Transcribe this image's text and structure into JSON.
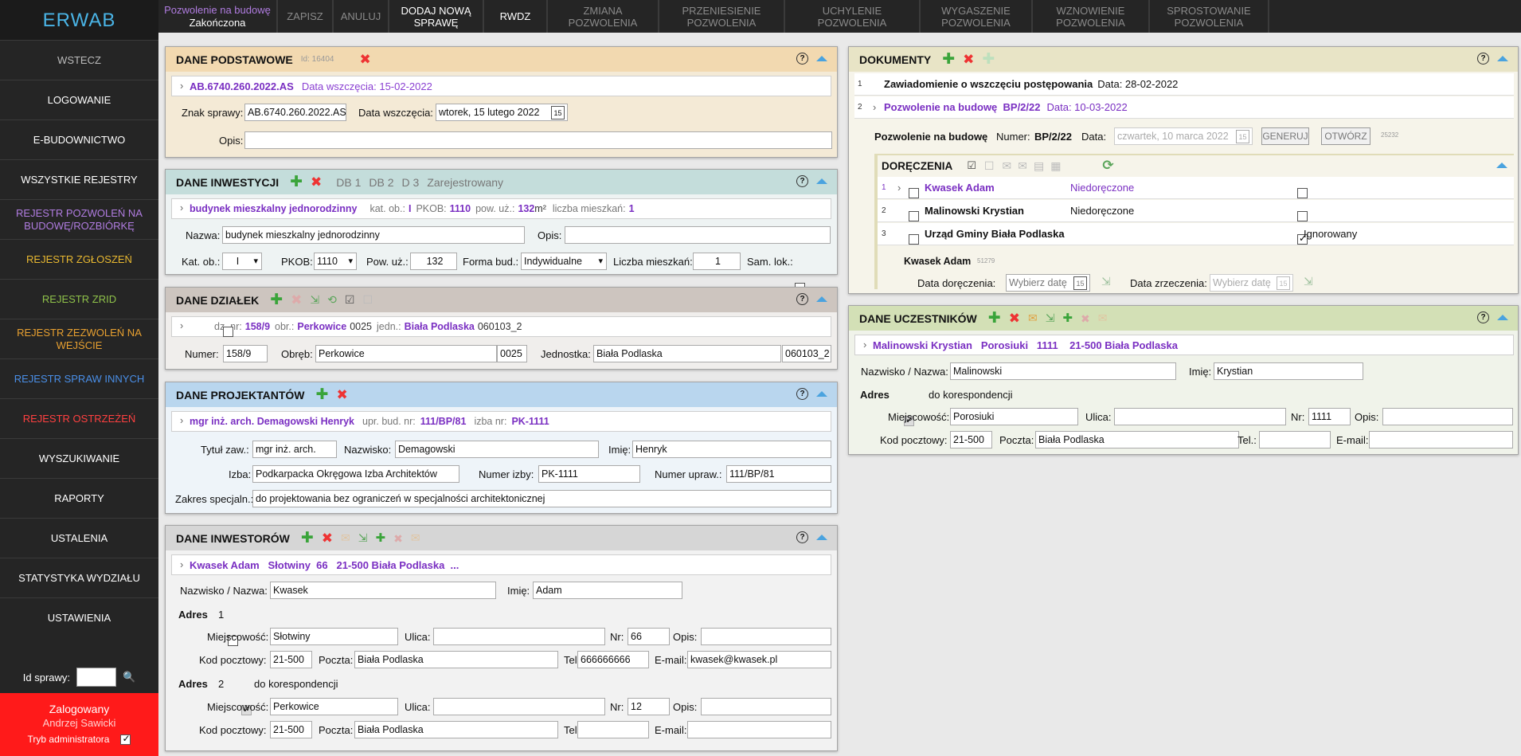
{
  "app": {
    "logo": "ERWAB"
  },
  "sidebar": {
    "items": [
      {
        "label": "WSTECZ",
        "color": "#bbbbbb"
      },
      {
        "label": "LOGOWANIE",
        "color": "#ffffff"
      },
      {
        "label": "E-BUDOWNICTWO",
        "color": "#ffffff"
      },
      {
        "label": "WSZYSTKIE REJESTRY",
        "color": "#ffffff"
      },
      {
        "label": "REJESTR POZWOLEŃ NA BUDOWĘ/ROZBIÓRKĘ",
        "color": "#b07ce0"
      },
      {
        "label": "REJESTR ZGŁOSZEŃ",
        "color": "#e8b830"
      },
      {
        "label": "REJESTR ZRID",
        "color": "#8fc24a"
      },
      {
        "label": "REJESTR ZEZWOLEŃ NA WEJŚCIE",
        "color": "#e8a030"
      },
      {
        "label": "REJESTR SPRAW INNYCH",
        "color": "#4a8fe8"
      },
      {
        "label": "REJESTR OSTRZEŻEŃ",
        "color": "#ff4040"
      },
      {
        "label": "WYSZUKIWANIE",
        "color": "#ffffff"
      },
      {
        "label": "RAPORTY",
        "color": "#ffffff"
      },
      {
        "label": "USTALENIA",
        "color": "#ffffff"
      },
      {
        "label": "STATYSTYKA WYDZIAŁU",
        "color": "#ffffff"
      },
      {
        "label": "USTAWIENIA",
        "color": "#ffffff"
      }
    ],
    "id_label": "Id sprawy:",
    "user": {
      "status": "Zalogowany",
      "name": "Andrzej Sawicki",
      "admin_label": "Tryb administratora"
    }
  },
  "topbar": {
    "case_type": "Pozwolenie na budowę",
    "case_status": "Zakończona",
    "tabs": [
      {
        "label": "ZAPISZ",
        "dim": true
      },
      {
        "label": "ANULUJ",
        "dim": true
      },
      {
        "label": "DODAJ NOWĄ SPRAWĘ",
        "dim": false
      },
      {
        "label": "RWDZ",
        "dim": false
      },
      {
        "label": "ZMIANA POZWOLENIA",
        "dim": true
      },
      {
        "label": "PRZENIESIENIE POZWOLENIA",
        "dim": true
      },
      {
        "label": "UCHYLENIE POZWOLENIA",
        "dim": true
      },
      {
        "label": "WYGASZENIE POZWOLENIA",
        "dim": true
      },
      {
        "label": "WZNOWIENIE POZWOLENIA",
        "dim": true
      },
      {
        "label": "SPROSTOWANIE POZWOLENIA",
        "dim": true
      }
    ]
  },
  "podstawowe": {
    "title": "DANE PODSTAWOWE",
    "id": "Id: 16404",
    "summary_sign": "AB.6740.260.2022.AS",
    "summary_date": "Data wszczęcia: 15-02-2022",
    "znak_label": "Znak sprawy:",
    "znak": "AB.6740.260.2022.AS",
    "data_label": "Data wszczęcia:",
    "data": "wtorek, 15 lutego 2022",
    "opis_label": "Opis:"
  },
  "inwestycji": {
    "title": "DANE INWESTYCJI",
    "tags": [
      "DB 1",
      "DB 2",
      "D 3",
      "Zarejestrowany"
    ],
    "summary_name": "budynek mieszkalny jednorodzinny",
    "s_kat_l": "kat. ob.:",
    "s_kat": "I",
    "s_pkob_l": "PKOB:",
    "s_pkob": "1110",
    "s_pow_l": "pow. uż.:",
    "s_pow": "132",
    "s_pow_unit": "m²",
    "s_lm_l": "liczba mieszkań:",
    "s_lm": "1",
    "nazwa_label": "Nazwa:",
    "nazwa": "budynek mieszkalny jednorodzinny",
    "opis_label": "Opis:",
    "kat_label": "Kat. ob.:",
    "kat": "I",
    "pkob_label": "PKOB:",
    "pkob": "1110",
    "pow_label": "Pow. uż.:",
    "pow": "132",
    "forma_label": "Forma bud.:",
    "forma": "Indywidualne",
    "lm_label": "Liczba mieszkań:",
    "lm": "1",
    "samlok_label": "Sam. lok.:"
  },
  "dzialek": {
    "title": "DANE DZIAŁEK",
    "s_dz_l": "dz. nr:",
    "s_dz": "158/9",
    "s_obr_l": "obr.:",
    "s_obr": "Perkowice",
    "s_obr_code": "0025",
    "s_jedn_l": "jedn.:",
    "s_jedn": "Biała Podlaska",
    "s_jedn_code": "060103_2",
    "numer_label": "Numer:",
    "numer": "158/9",
    "obreb_label": "Obręb:",
    "obreb": "Perkowice",
    "obreb_code": "0025",
    "jedn_label": "Jednostka:",
    "jedn": "Biała Podlaska",
    "jedn_code": "060103_2"
  },
  "projektantow": {
    "title": "DANE PROJEKTANTÓW",
    "s_name": "mgr inż. arch. Demagowski Henryk",
    "s_upr_l": "upr. bud. nr:",
    "s_upr": "111/BP/81",
    "s_izba_l": "izba nr:",
    "s_izba": "PK-1111",
    "tytul_label": "Tytuł zaw.:",
    "tytul": "mgr inż. arch.",
    "nazwisko_label": "Nazwisko:",
    "nazwisko": "Demagowski",
    "imie_label": "Imię:",
    "imie": "Henryk",
    "izba_label": "Izba:",
    "izba": "Podkarpacka Okręgowa Izba Architektów",
    "nrizby_label": "Numer izby:",
    "nrizby": "PK-1111",
    "nrupr_label": "Numer upraw.:",
    "nrupr": "111/BP/81",
    "zakres_label": "Zakres specjaln.:",
    "zakres": "do projektowania bez ograniczeń w specjalności architektonicznej"
  },
  "inwestorow": {
    "title": "DANE INWESTORÓW",
    "summary": "Kwasek Adam   Słotwiny  66   21-500 Biała Podlaska  ...",
    "nazw_label": "Nazwisko / Nazwa:",
    "nazw": "Kwasek",
    "imie_label": "Imię:",
    "imie": "Adam",
    "adres_label": "Adres",
    "kores_label": "do korespondencji",
    "addr1": {
      "no": "1",
      "miejsc": "Słotwiny",
      "ulica": "",
      "nr": "66",
      "opis": "",
      "kod": "21-500",
      "poczta": "Biała Podlaska",
      "tel": "666666666",
      "email": "kwasek@kwasek.pl"
    },
    "addr2": {
      "no": "2",
      "miejsc": "Perkowice",
      "ulica": "",
      "nr": "12",
      "opis": "",
      "kod": "21-500",
      "poczta": "Biała Podlaska",
      "tel": "",
      "email": ""
    },
    "l_miejsc": "Miejscowość:",
    "l_ulica": "Ulica:",
    "l_nr": "Nr:",
    "l_opis": "Opis:",
    "l_kod": "Kod pocztowy:",
    "l_poczta": "Poczta:",
    "l_tel": "Tel.:",
    "l_email": "E-mail:"
  },
  "dokumenty": {
    "title": "DOKUMENTY",
    "rows": [
      {
        "no": "1",
        "name": "Zawiadomienie o wszczęciu postępowania",
        "date": "Data: 28-02-2022"
      },
      {
        "no": "2",
        "name": "Pozwolenie na budowę  BP/2/22",
        "date": "Data: 10-03-2022"
      }
    ],
    "det_name": "Pozwolenie na budowę",
    "det_num_l": "Numer:",
    "det_num": "BP/2/22",
    "det_data_l": "Data:",
    "det_data": "czwartek, 10 marca 2022",
    "generuj": "GENERUJ",
    "otworz": "OTWÓRZ",
    "det_id": "25232",
    "dor_title": "DORĘCZENIA",
    "dor_rows": [
      {
        "no": "1",
        "name": "Kwasek Adam",
        "status": "Niedoręczone",
        "ign": "",
        "checked": false
      },
      {
        "no": "2",
        "name": "Malinowski Krystian",
        "status": "Niedoręczone",
        "ign": "",
        "checked": false
      },
      {
        "no": "3",
        "name": "Urząd Gminy Biała Podlaska",
        "status": "",
        "ign": "Ignorowany",
        "checked": true
      }
    ],
    "dor_person": "Kwasek Adam",
    "dor_person_id": "51279",
    "dor_date_l": "Data doręczenia:",
    "dor_date": "Wybierz datę",
    "zrz_l": "Data zrzeczenia:",
    "zrz": "Wybierz datę"
  },
  "uczestnikow": {
    "title": "DANE UCZESTNIKÓW",
    "summary": "Malinowski Krystian   Porosiuki   1111    21-500 Biała Podlaska",
    "nazw_label": "Nazwisko / Nazwa:",
    "nazw": "Malinowski",
    "imie_label": "Imię:",
    "imie": "Krystian",
    "adres_label": "Adres",
    "kores_label": "do korespondencji",
    "miejsc": "Porosiuki",
    "ulica": "",
    "nr": "1111",
    "opis": "",
    "kod": "21-500",
    "poczta": "Biała Podlaska",
    "tel": "",
    "email": ""
  }
}
